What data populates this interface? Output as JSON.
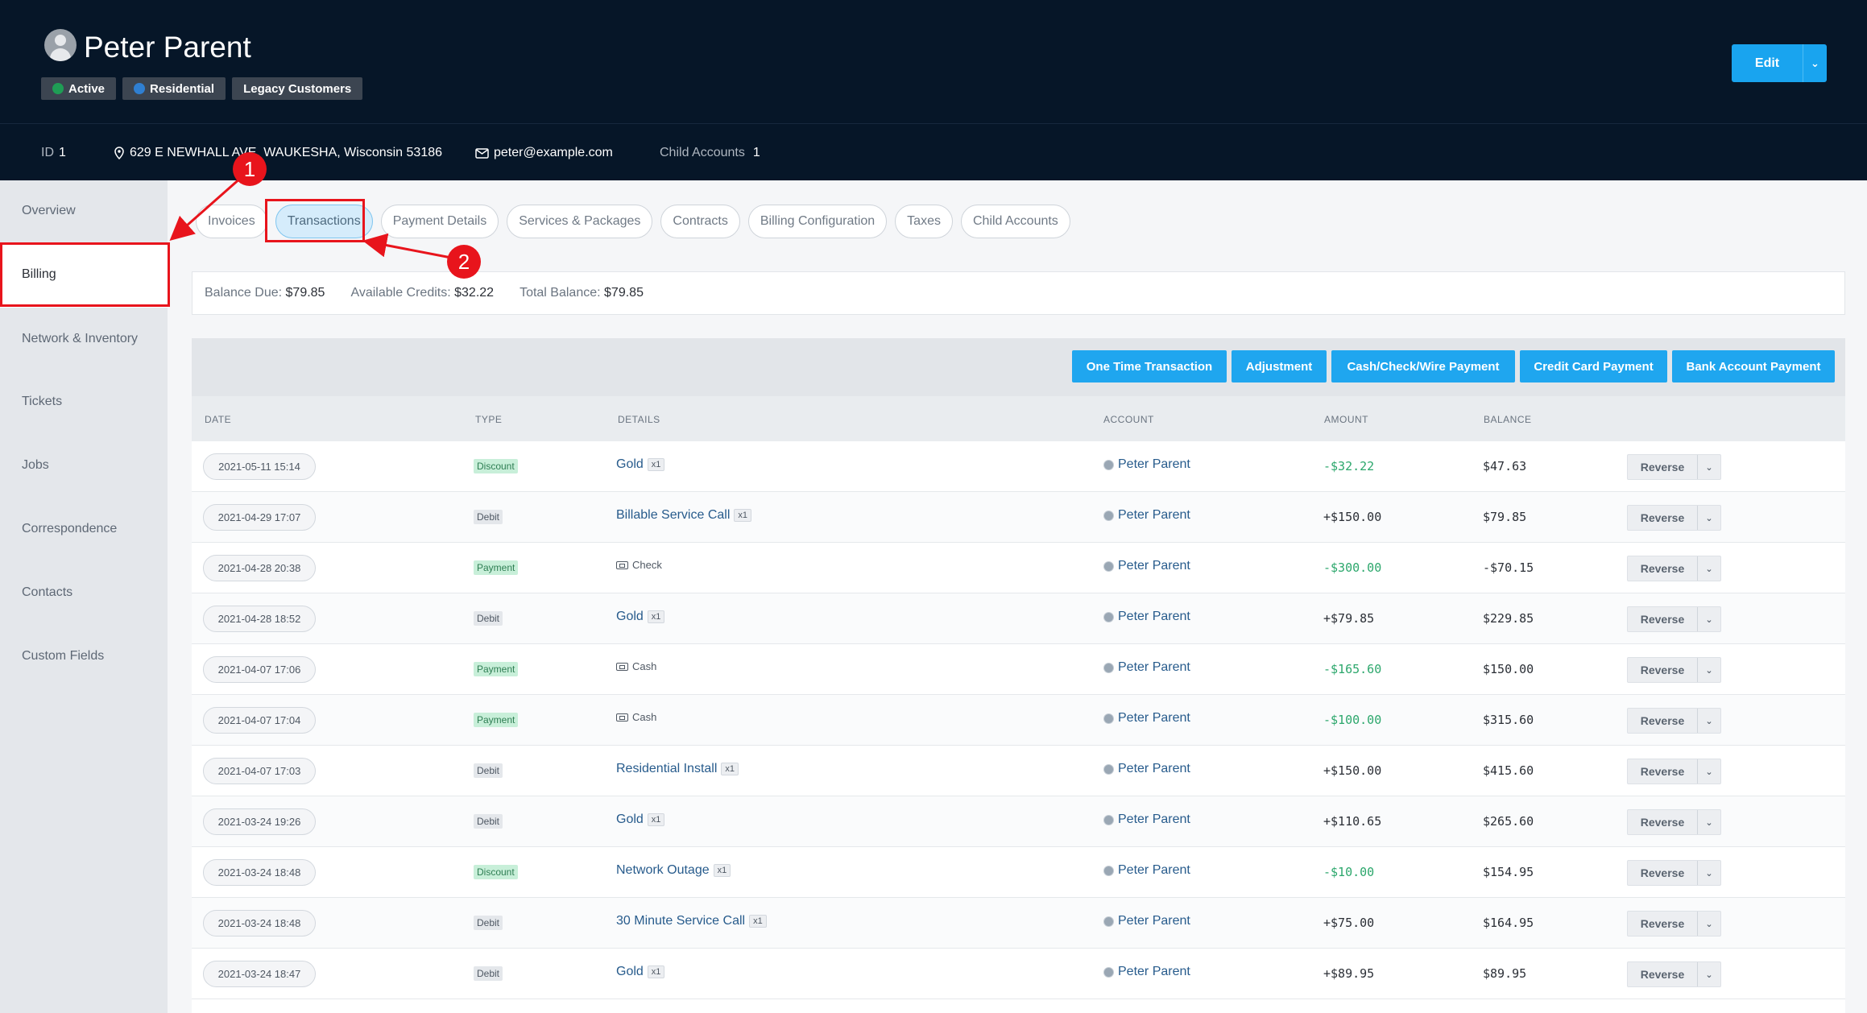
{
  "customer": {
    "name": "Peter Parent",
    "badges": [
      {
        "label": "Active",
        "dot_color": "#1f9d55"
      },
      {
        "label": "Residential",
        "dot_color": "#2f7fd1"
      },
      {
        "label": "Legacy Customers",
        "dot_color": ""
      }
    ],
    "edit_label": "Edit",
    "id_label": "ID",
    "id_value": "1",
    "address": "629 E NEWHALL AVE, WAUKESHA, Wisconsin 53186",
    "email": "peter@example.com",
    "child_accounts_label": "Child Accounts",
    "child_accounts_value": "1"
  },
  "sidebar": {
    "items": [
      {
        "label": "Overview"
      },
      {
        "label": "Billing"
      },
      {
        "label": "Network & Inventory"
      },
      {
        "label": "Tickets"
      },
      {
        "label": "Jobs"
      },
      {
        "label": "Correspondence"
      },
      {
        "label": "Contacts"
      },
      {
        "label": "Custom Fields"
      }
    ],
    "active": "Billing"
  },
  "tabs": [
    {
      "label": "Invoices"
    },
    {
      "label": "Transactions"
    },
    {
      "label": "Payment Details"
    },
    {
      "label": "Services & Packages"
    },
    {
      "label": "Contracts"
    },
    {
      "label": "Billing Configuration"
    },
    {
      "label": "Taxes"
    },
    {
      "label": "Child Accounts"
    }
  ],
  "active_tab": "Transactions",
  "balances": {
    "due_label": "Balance Due:",
    "due": "$79.85",
    "credits_label": "Available Credits:",
    "credits": "$32.22",
    "total_label": "Total Balance:",
    "total": "$79.85"
  },
  "toolbar": {
    "buttons": [
      {
        "label": "One Time Transaction"
      },
      {
        "label": "Adjustment"
      },
      {
        "label": "Cash/Check/Wire Payment"
      },
      {
        "label": "Credit Card Payment"
      },
      {
        "label": "Bank Account Payment"
      }
    ]
  },
  "table": {
    "headers": [
      "DATE",
      "TYPE",
      "DETAILS",
      "ACCOUNT",
      "AMOUNT",
      "BALANCE"
    ],
    "reverse_label": "Reverse",
    "rows": [
      {
        "date": "2021-05-11 15:14",
        "type": "Discount",
        "details": "Gold",
        "qty": "x1",
        "method": "",
        "account": "Peter Parent",
        "amount": "-$32.22",
        "balance": "$47.63"
      },
      {
        "date": "2021-04-29 17:07",
        "type": "Debit",
        "details": "Billable Service Call",
        "qty": "x1",
        "method": "",
        "account": "Peter Parent",
        "amount": "+$150.00",
        "balance": "$79.85"
      },
      {
        "date": "2021-04-28 20:38",
        "type": "Payment",
        "details": "",
        "qty": "",
        "method": "Check",
        "account": "Peter Parent",
        "amount": "-$300.00",
        "balance": "-$70.15"
      },
      {
        "date": "2021-04-28 18:52",
        "type": "Debit",
        "details": "Gold",
        "qty": "x1",
        "method": "",
        "account": "Peter Parent",
        "amount": "+$79.85",
        "balance": "$229.85"
      },
      {
        "date": "2021-04-07 17:06",
        "type": "Payment",
        "details": "",
        "qty": "",
        "method": "Cash",
        "account": "Peter Parent",
        "amount": "-$165.60",
        "balance": "$150.00"
      },
      {
        "date": "2021-04-07 17:04",
        "type": "Payment",
        "details": "",
        "qty": "",
        "method": "Cash",
        "account": "Peter Parent",
        "amount": "-$100.00",
        "balance": "$315.60"
      },
      {
        "date": "2021-04-07 17:03",
        "type": "Debit",
        "details": "Residential Install",
        "qty": "x1",
        "method": "",
        "account": "Peter Parent",
        "amount": "+$150.00",
        "balance": "$415.60"
      },
      {
        "date": "2021-03-24 19:26",
        "type": "Debit",
        "details": "Gold",
        "qty": "x1",
        "method": "",
        "account": "Peter Parent",
        "amount": "+$110.65",
        "balance": "$265.60"
      },
      {
        "date": "2021-03-24 18:48",
        "type": "Discount",
        "details": "Network Outage",
        "qty": "x1",
        "method": "",
        "account": "Peter Parent",
        "amount": "-$10.00",
        "balance": "$154.95"
      },
      {
        "date": "2021-03-24 18:48",
        "type": "Debit",
        "details": "30 Minute Service Call",
        "qty": "x1",
        "method": "",
        "account": "Peter Parent",
        "amount": "+$75.00",
        "balance": "$164.95"
      },
      {
        "date": "2021-03-24 18:47",
        "type": "Debit",
        "details": "Gold",
        "qty": "x1",
        "method": "",
        "account": "Peter Parent",
        "amount": "+$89.95",
        "balance": "$89.95"
      }
    ]
  },
  "annotations": [
    {
      "number": "1"
    },
    {
      "number": "2"
    }
  ]
}
